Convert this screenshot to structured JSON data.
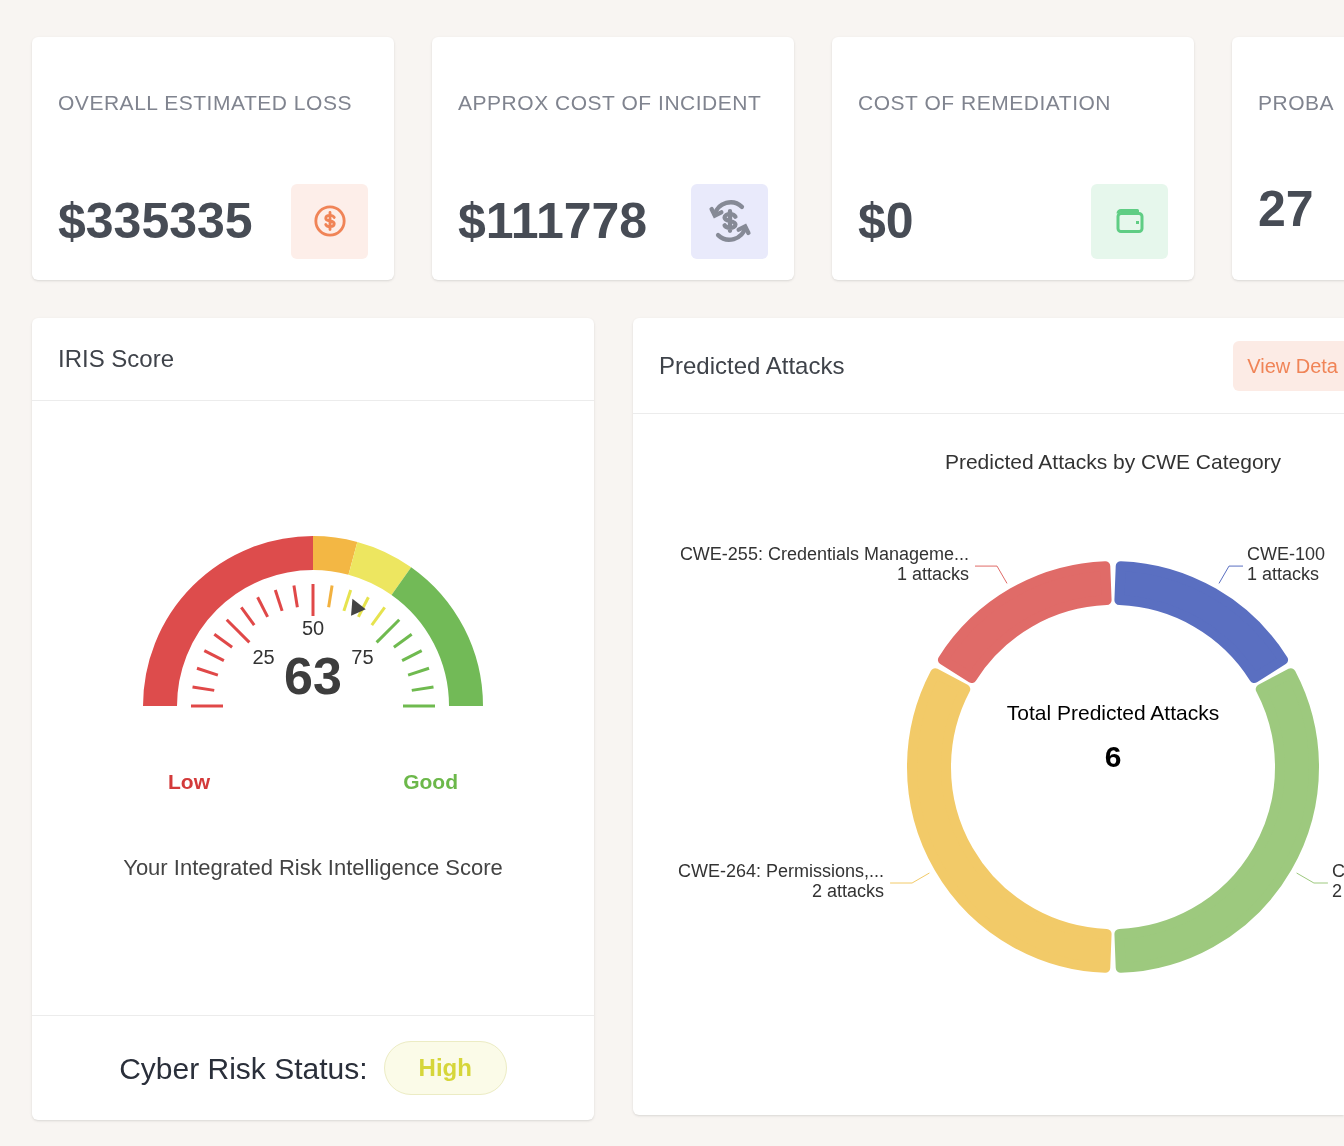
{
  "summary_cards": [
    {
      "kind": "loss",
      "title": "OVERALL ESTIMATED LOSS",
      "value": "$335335"
    },
    {
      "kind": "incident",
      "title": "APPROX COST OF INCIDENT",
      "value": "$111778"
    },
    {
      "kind": "remediation",
      "title": "COST OF REMEDIATION",
      "value": "$0"
    },
    {
      "kind": "probability",
      "title": "PROBA",
      "value": "27"
    }
  ],
  "iris": {
    "title": "IRIS Score",
    "score": "63",
    "level": 0.63,
    "scale_labels": [
      "25",
      "50",
      "75"
    ],
    "low_label": "Low",
    "high_label": "Good",
    "caption": "Your Integrated Risk Intelligence Score",
    "status_label": "Cyber Risk Status:",
    "status": "High"
  },
  "predicted": {
    "title": "Predicted Attacks",
    "button": "View Deta",
    "center_label": "Total Predicted Attacks",
    "center_value": "6",
    "chart_data": {
      "type": "donut",
      "title": "Predicted Attacks by CWE Category",
      "categories": [
        "CWE-100",
        "C",
        "CWE-264: Permissions,...",
        "CWE-255: Credentials Manageme..."
      ],
      "values": [
        1,
        2,
        2,
        1
      ],
      "colors": [
        "#5a6fc1",
        "#9dc97e",
        "#f2ca68",
        "#e06b68"
      ],
      "value_labels": [
        "1 attacks",
        "2",
        "2 attacks",
        "1 attacks"
      ]
    }
  }
}
